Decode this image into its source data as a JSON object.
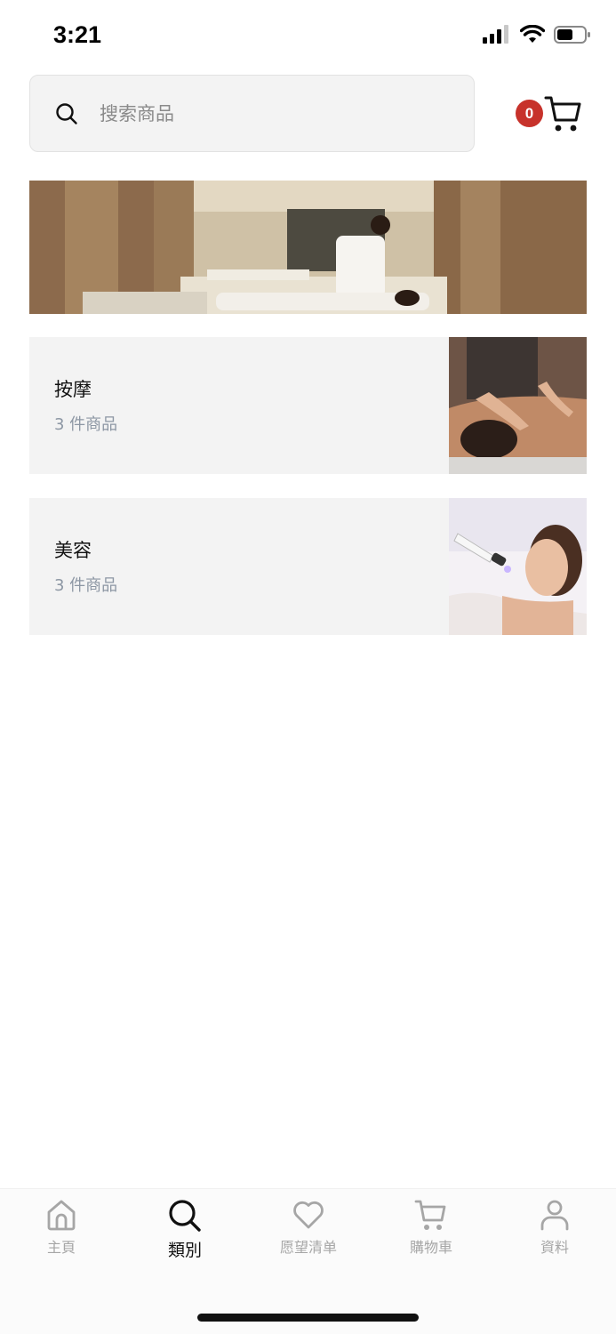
{
  "status_bar": {
    "time": "3:21"
  },
  "header": {
    "search": {
      "placeholder": "搜索商品"
    },
    "cart": {
      "count": "0"
    }
  },
  "categories": [
    {
      "name": "按摩",
      "count": "3 件商品"
    },
    {
      "name": "美容",
      "count": "3 件商品"
    }
  ],
  "bottom_nav": {
    "items": [
      {
        "label": "主頁",
        "icon": "home-icon",
        "active": false
      },
      {
        "label": "類別",
        "icon": "search-icon",
        "active": true
      },
      {
        "label": "愿望清单",
        "icon": "heart-icon",
        "active": false
      },
      {
        "label": "購物車",
        "icon": "cart-icon",
        "active": false
      },
      {
        "label": "資料",
        "icon": "user-icon",
        "active": false
      }
    ]
  },
  "colors": {
    "badge": "#c7322b",
    "card_background": "#f3f3f3",
    "muted_text": "#8d97a4",
    "nav_inactive": "#a6a6a6"
  }
}
